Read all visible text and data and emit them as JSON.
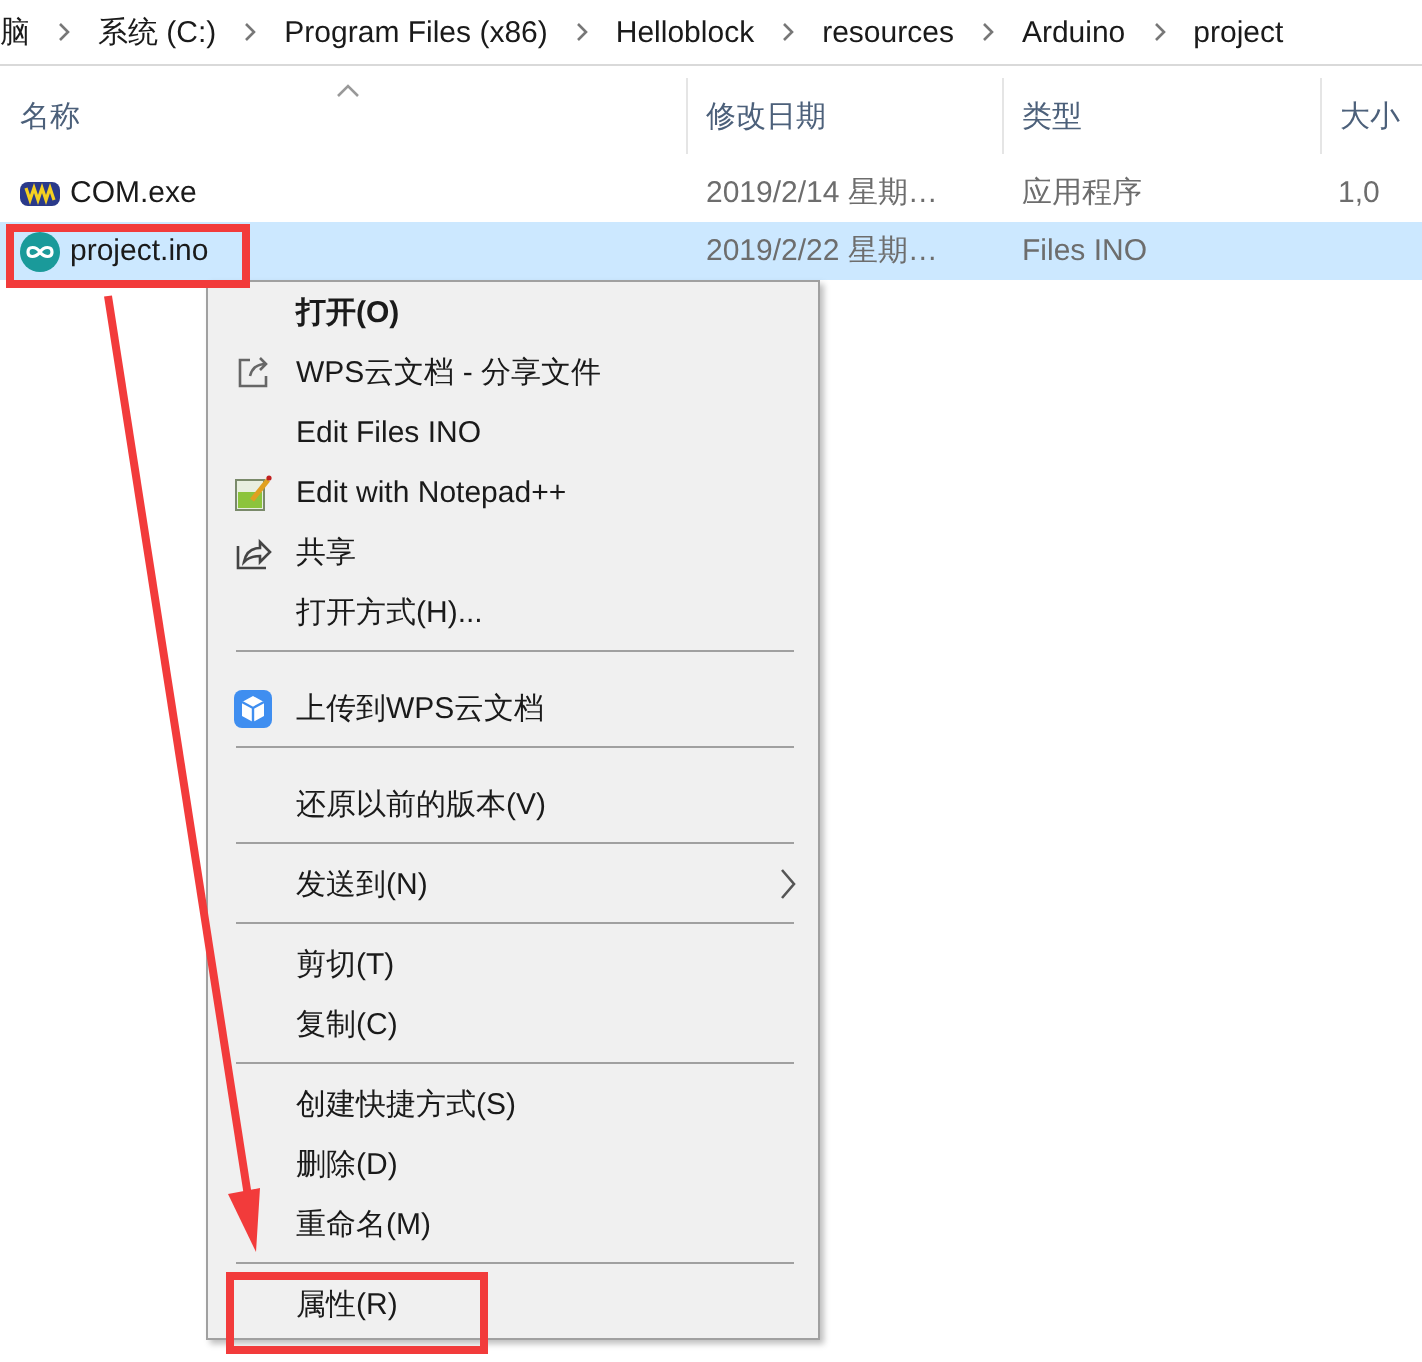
{
  "breadcrumb": [
    "脑",
    "系统 (C:)",
    "Program Files (x86)",
    "Helloblock",
    "resources",
    "Arduino",
    "project"
  ],
  "columns": [
    {
      "label": "名称",
      "sorted": true
    },
    {
      "label": "修改日期",
      "sorted": false
    },
    {
      "label": "类型",
      "sorted": false
    },
    {
      "label": "大小",
      "sorted": false
    }
  ],
  "files": [
    {
      "name": "COM.exe",
      "date": "2019/2/14 星期…",
      "type": "应用程序",
      "size": "1,0",
      "kind": "exe",
      "selected": false
    },
    {
      "name": "project.ino",
      "date": "2019/2/22 星期…",
      "type": "Files INO",
      "kind": "ino",
      "selected": true
    }
  ],
  "context_menu": [
    {
      "kind": "item",
      "label": "打开(O)",
      "bold": true
    },
    {
      "kind": "item",
      "label": "WPS云文档 - 分享文件",
      "bold": false
    },
    {
      "kind": "item",
      "label": "Edit Files INO",
      "bold": false
    },
    {
      "kind": "item",
      "label": "Edit with Notepad++",
      "bold": false
    },
    {
      "kind": "item",
      "label": "共享",
      "bold": false
    },
    {
      "kind": "item",
      "label": "打开方式(H)...",
      "bold": false
    },
    {
      "kind": "separator"
    },
    {
      "kind": "item",
      "label": "上传到WPS云文档",
      "bold": false
    },
    {
      "kind": "separator"
    },
    {
      "kind": "item",
      "label": "还原以前的版本(V)",
      "bold": false
    },
    {
      "kind": "separator"
    },
    {
      "kind": "item",
      "label": "发送到(N)",
      "bold": false,
      "submenu": true
    },
    {
      "kind": "separator"
    },
    {
      "kind": "item",
      "label": "剪切(T)",
      "bold": false
    },
    {
      "kind": "item",
      "label": "复制(C)",
      "bold": false
    },
    {
      "kind": "separator"
    },
    {
      "kind": "item",
      "label": "创建快捷方式(S)",
      "bold": false
    },
    {
      "kind": "item",
      "label": "删除(D)",
      "bold": false
    },
    {
      "kind": "item",
      "label": "重命名(M)",
      "bold": false
    },
    {
      "kind": "separator"
    },
    {
      "kind": "item",
      "label": "属性(R)",
      "bold": false
    }
  ]
}
